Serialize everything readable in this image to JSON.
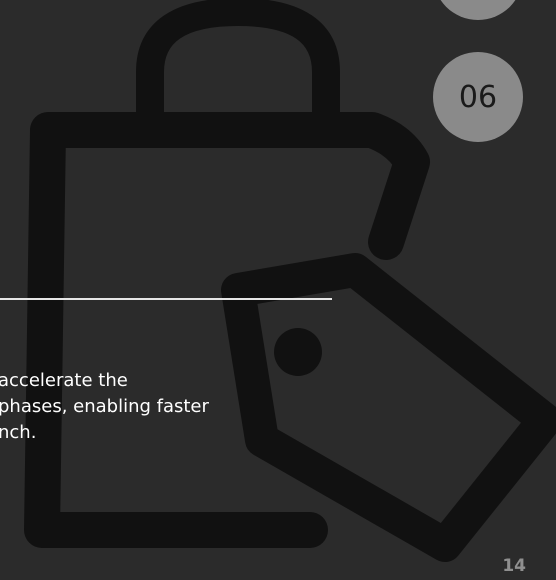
{
  "steps": {
    "previous_label": "",
    "current_label": "06"
  },
  "body": {
    "line1": "accelerate the",
    "line2": "phases, enabling faster",
    "line3": "nch."
  },
  "footer": {
    "page_number": "14"
  },
  "icons": {
    "background": "shopping-bag-tag-icon"
  },
  "colors": {
    "background": "#2b2b2b",
    "icon_outline": "#111111",
    "step_circle": "#8a8a8a",
    "divider": "#e6e6e6",
    "body_text": "#ffffff",
    "page_number": "#8f8f8f"
  }
}
